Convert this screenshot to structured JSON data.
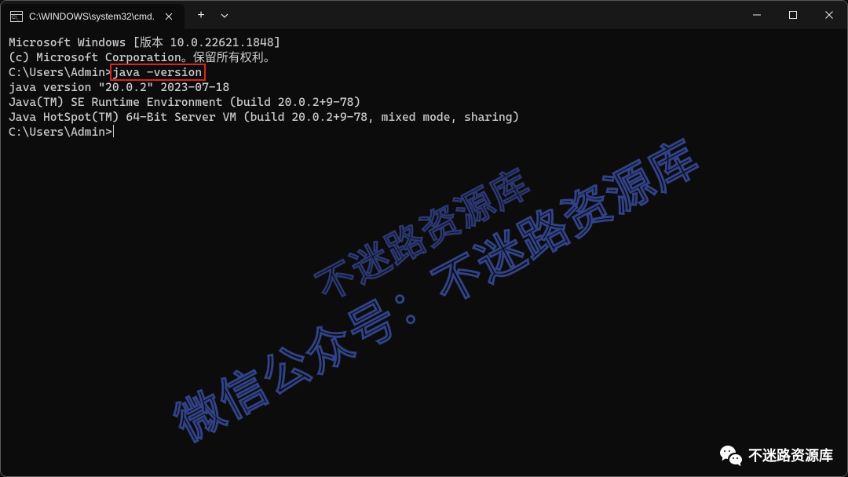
{
  "window": {
    "tab_title": "C:\\WINDOWS\\system32\\cmd."
  },
  "terminal": {
    "lines": [
      "Microsoft Windows [版本 10.0.22621.1848]",
      "(c) Microsoft Corporation。保留所有权利。",
      "",
      "C:\\Users\\Admin>",
      "java -version",
      "java version \"20.0.2\" 2023-07-18",
      "Java(TM) SE Runtime Environment (build 20.0.2+9-78)",
      "Java HotSpot(TM) 64-Bit Server VM (build 20.0.2+9-78, mixed mode, sharing)",
      "",
      "C:\\Users\\Admin>"
    ]
  },
  "watermark": {
    "line1": "不迷路资源库",
    "line2": "微信公众号：不迷路资源库"
  },
  "badge": {
    "text": "不迷路资源库"
  }
}
